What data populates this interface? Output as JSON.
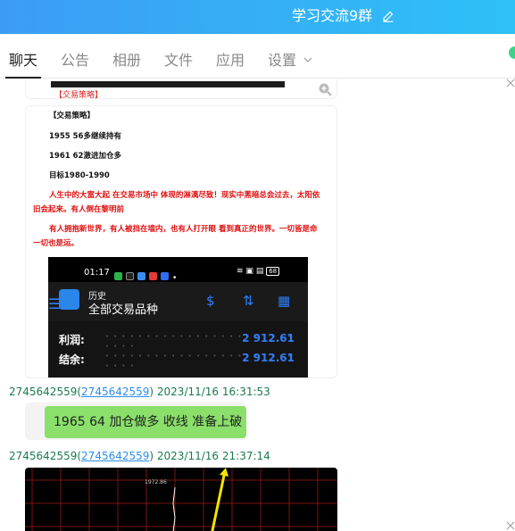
{
  "window": {
    "title": "学习交流9群"
  },
  "tabs": [
    {
      "label": "聊天"
    },
    {
      "label": "公告"
    },
    {
      "label": "相册"
    },
    {
      "label": "文件"
    },
    {
      "label": "应用"
    },
    {
      "label": "设置"
    }
  ],
  "messages": {
    "card1": {
      "caption": "【交易策略】"
    },
    "strategy": {
      "heading": "【交易策略】",
      "line1": "1955 56多继续持有",
      "line2": "1961 62激进加仓多",
      "line3": "目标1980-1990",
      "red1a": "人生中的大富大起 在交易市场中 体现的淋漓尽致！现实中黑暗总会过去，太阳依",
      "red1b": "旧会起来。有人倒在黎明前",
      "red2a": "有人拥抱新世界，有人被挡在墙内，也有人打开眼 看到真正的世界。一切皆是命",
      "red2b": "一切也是运。"
    },
    "phone": {
      "time": "01:17",
      "battery": "68",
      "header_sub": "历史",
      "header_main": "全部交易品种",
      "profit_label": "利润:",
      "profit_value": "2 912.61",
      "balance_label": "结余:",
      "balance_value": "2 912.61",
      "dots": "· · · · · · · · · · · · · · · · · · · · · · · · · · ·"
    },
    "msg1": {
      "sender": "2745642559",
      "sender_link": "2745642559",
      "time": "2023/11/16 16:31:53",
      "text": "1965 64 加仓做多  收线 准备上破"
    },
    "msg2": {
      "sender": "2745642559",
      "sender_link": "2745642559",
      "time": "2023/11/16 21:37:14",
      "chart_label": "1972.86"
    }
  },
  "colors": {
    "header_start": "#3c9cf5",
    "header_end": "#2ec1f6",
    "bubble": "#8ae06a",
    "meta": "#1b7a4e",
    "red_text": "#e01010"
  }
}
